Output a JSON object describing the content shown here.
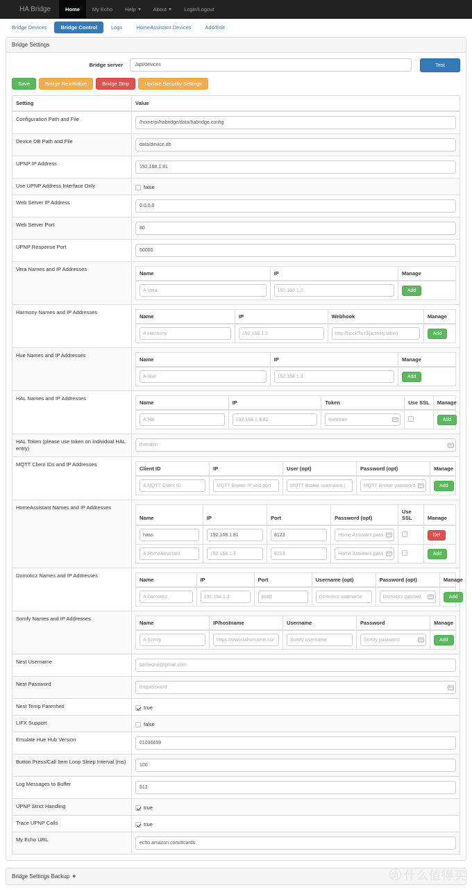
{
  "navbar": {
    "brand": "HA Bridge",
    "items": [
      {
        "label": "Home",
        "active": true,
        "caret": false
      },
      {
        "label": "My Echo",
        "active": false,
        "caret": false
      },
      {
        "label": "Help",
        "active": false,
        "caret": true
      },
      {
        "label": "About",
        "active": false,
        "caret": true
      },
      {
        "label": "Login/Logout",
        "active": false,
        "caret": false
      }
    ]
  },
  "tabs": [
    {
      "label": "Bridge Devices",
      "active": false
    },
    {
      "label": "Bridge Control",
      "active": true
    },
    {
      "label": "Logs",
      "active": false
    },
    {
      "label": "HomeAssistant Devices",
      "active": false
    },
    {
      "label": "Add/Edit",
      "active": false
    }
  ],
  "panel": {
    "heading": "Bridge Settings",
    "bridge_server": {
      "label": "Bridge server",
      "value": "./api/devices",
      "test_button": "Test"
    },
    "actions": [
      {
        "label": "Save",
        "style": "success"
      },
      {
        "label": "Bridge Reinitialize",
        "style": "warning"
      },
      {
        "label": "Bridge Stop",
        "style": "danger"
      },
      {
        "label": "Update Security Settings",
        "style": "warning"
      }
    ],
    "table_headers": {
      "setting": "Setting",
      "value": "Value"
    }
  },
  "rows": {
    "config_path": {
      "label": "Configuration Path and File",
      "value": "/home/pi/habridge/data/habridge.config"
    },
    "device_db": {
      "label": "Device DB Path and File",
      "value": "data/device.db"
    },
    "upnp_ip": {
      "label": "UPNP IP Address",
      "value": "192.168.1.81"
    },
    "upnp_iface_only": {
      "label": "Use UPNP Address Interface Only",
      "value": "false",
      "checked": false
    },
    "web_ip": {
      "label": "Web Server IP Address",
      "value": "0.0.0.0"
    },
    "web_port": {
      "label": "Web Server Port",
      "value": "80"
    },
    "upnp_response_port": {
      "label": "UPNP Response Port",
      "value": "50000"
    },
    "hal_token": {
      "label": "HAL Token (please use token on individual HAL entry)",
      "placeholder": "thetoken"
    },
    "nest_username": {
      "label": "Nest Username",
      "placeholder": "someone@gmail.com"
    },
    "nest_password": {
      "label": "Nest Password",
      "placeholder": "thepassword"
    },
    "nest_farenheit": {
      "label": "Nest Temp Farenheit",
      "value": "true",
      "checked": true
    },
    "lifx": {
      "label": "LIFX Support",
      "value": "false",
      "checked": false
    },
    "hue_hub_version": {
      "label": "Emulate Hue Hub Version",
      "value": "01036659"
    },
    "button_sleep": {
      "label": "Button Press/Call Item Loop Sleep Interval (ms)",
      "value": "100"
    },
    "log_buffer": {
      "label": "Log Messages to Buffer",
      "value": "512"
    },
    "upnp_strict": {
      "label": "UPNP Strict Handling",
      "value": "true",
      "checked": true
    },
    "trace_upnp": {
      "label": "Trace UPNP Calls",
      "value": "true",
      "checked": true
    },
    "my_echo_url": {
      "label": "My Echo URL",
      "value": "echo.amazon.com/#cards"
    }
  },
  "vera": {
    "label": "Vera Names and IP Addresses",
    "headers": [
      "Name",
      "IP",
      "Manage"
    ],
    "entries": [
      {
        "name": "",
        "name_ph": "A Vera",
        "ip": "",
        "ip_ph": "192.168.1.2",
        "action": "Add",
        "style": "success"
      }
    ]
  },
  "harmony": {
    "label": "Harmony Names and IP Addresses",
    "headers": [
      "Name",
      "IP",
      "Webhook",
      "Manage"
    ],
    "entries": [
      {
        "name": "",
        "name_ph": "A Harmony",
        "ip": "",
        "ip_ph": "192.168.1.3",
        "webhook": "",
        "webhook_ph": "http://hook?a=${activity.label}",
        "action": "Add",
        "style": "success"
      }
    ]
  },
  "hue": {
    "label": "Hue Names and IP Addresses",
    "headers": [
      "Name",
      "IP",
      "Manage"
    ],
    "entries": [
      {
        "name": "",
        "name_ph": "A Hue",
        "ip": "",
        "ip_ph": "192.168.1.3",
        "action": "Add",
        "style": "success"
      }
    ]
  },
  "hal": {
    "label": "HAL Names and IP Addresses",
    "headers": [
      "Name",
      "IP",
      "Token",
      "Use SSL",
      "Manage"
    ],
    "entries": [
      {
        "name": "",
        "name_ph": "A Hal",
        "ip": "",
        "ip_ph": "192.168.1.3:82",
        "token": "",
        "token_ph": "thetoken",
        "ssl": false,
        "action": "Add",
        "style": "success"
      }
    ]
  },
  "mqtt": {
    "label": "MQTT Client IDs and IP Addresses",
    "headers": [
      "Client ID",
      "IP",
      "User (opt)",
      "Password (opt)",
      "Manage"
    ],
    "entries": [
      {
        "client_id": "",
        "client_id_ph": "A MQTT Client ID",
        "ip": "",
        "ip_ph": "MQTT Broker IP and port",
        "user": "",
        "user_ph": "MQTT Broker username (",
        "password": "",
        "password_ph": "MQTT Broker password",
        "action": "Add",
        "style": "success"
      }
    ]
  },
  "homeassistant": {
    "label": "HomeAssistant Names and IP Addresses",
    "headers": [
      "Name",
      "IP",
      "Port",
      "Password (opt)",
      "Use SSL",
      "Manage"
    ],
    "entries": [
      {
        "name": "hass",
        "name_ph": "",
        "ip": "192.168.1.81",
        "ip_ph": "",
        "port": "8123",
        "port_ph": "",
        "password": "",
        "password_ph": "Home Assistant pass",
        "ssl": false,
        "action": "Del",
        "style": "danger"
      },
      {
        "name": "",
        "name_ph": "A HomeAssistant",
        "ip": "",
        "ip_ph": "192.168.1.3",
        "port": "",
        "port_ph": "8123",
        "password": "",
        "password_ph": "Home Assistant pass",
        "ssl": false,
        "action": "Add",
        "style": "success"
      }
    ]
  },
  "domoticz": {
    "label": "Domoticz Names and IP Addresses",
    "headers": [
      "Name",
      "IP",
      "Port",
      "Username (opt)",
      "Password (opt)",
      "Manage"
    ],
    "entries": [
      {
        "name": "",
        "name_ph": "A Domoticz",
        "ip": "",
        "ip_ph": "192.168.1.3",
        "port": "",
        "port_ph": "8080",
        "user": "",
        "user_ph": "Domoticz username",
        "password": "",
        "password_ph": "Domoticz passwd",
        "action": "Add",
        "style": "success"
      }
    ]
  },
  "somfy": {
    "label": "Somfy Names and IP Addresses",
    "headers": [
      "Name",
      "IP/hostname",
      "Username",
      "Password",
      "Manage"
    ],
    "entries": [
      {
        "name": "",
        "name_ph": "A Somfy",
        "ip": "",
        "ip_ph": "https://www.tahomalink.cor",
        "user": "",
        "user_ph": "Somfy username",
        "password": "",
        "password_ph": "Somfy password",
        "action": "Add",
        "style": "success"
      }
    ]
  },
  "backup": {
    "heading": "Bridge Settings Backup",
    "expand_icon": "+"
  },
  "watermark": {
    "badge": "值",
    "text": "什么值得买"
  },
  "colors": {
    "primary": "#337ab7",
    "success": "#5cb85c",
    "warning": "#f0ad4e",
    "danger": "#d9534f",
    "navbar_bg": "#222222"
  }
}
